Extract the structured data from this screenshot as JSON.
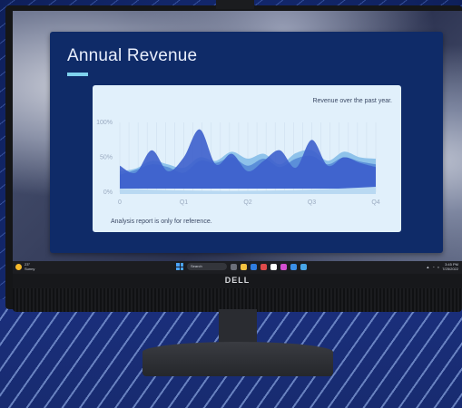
{
  "slide": {
    "title": "Annual Revenue",
    "accent_color": "#7fd2ee",
    "chart_caption": "Revenue over the past year.",
    "footnote": "Analysis report is only for reference."
  },
  "chart_data": {
    "type": "area",
    "title": "Revenue over the past year.",
    "y_ticks": [
      "100%",
      "50%",
      "0%"
    ],
    "x_ticks": [
      "0",
      "Q1",
      "Q2",
      "Q3",
      "Q4"
    ],
    "ylim": [
      0,
      100
    ],
    "grid": true,
    "x": [
      0,
      0.25,
      0.5,
      0.75,
      1,
      1.25,
      1.5,
      1.75,
      2,
      2.25,
      2.5,
      2.75,
      3,
      3.25,
      3.5,
      3.75,
      4
    ],
    "series": [
      {
        "color": "#8ec2ea",
        "values": [
          30,
          34,
          45,
          40,
          35,
          50,
          45,
          58,
          48,
          55,
          40,
          56,
          60,
          45,
          58,
          50,
          48
        ]
      },
      {
        "color": "#5b8fd9",
        "values": [
          25,
          32,
          40,
          36,
          28,
          45,
          42,
          50,
          38,
          48,
          36,
          48,
          52,
          40,
          50,
          44,
          40
        ]
      },
      {
        "color": "#3d5fcc",
        "values": [
          38,
          28,
          60,
          30,
          50,
          90,
          40,
          55,
          30,
          45,
          60,
          35,
          75,
          38,
          50,
          42,
          36
        ]
      }
    ]
  },
  "taskbar": {
    "weather_temp": "23°",
    "weather_text": "Sunny",
    "search_placeholder": "Search",
    "tray_time": "3:45 PM",
    "tray_date": "7/25/2022"
  },
  "monitor": {
    "brand": "DELL"
  }
}
